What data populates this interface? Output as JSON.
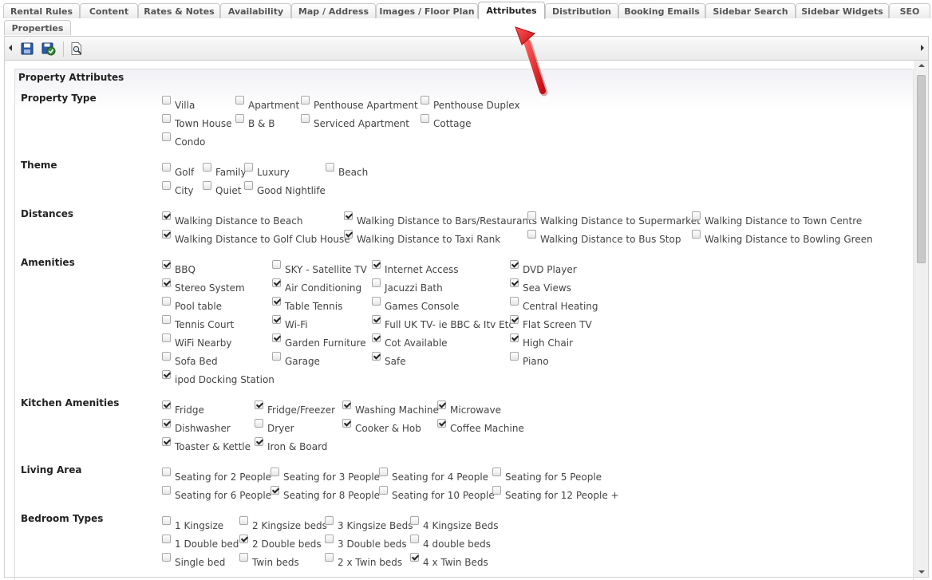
{
  "tabs": [
    {
      "label": "Rental Rules",
      "active": false
    },
    {
      "label": "Content",
      "active": false
    },
    {
      "label": "Rates & Notes",
      "active": false
    },
    {
      "label": "Availability",
      "active": false
    },
    {
      "label": "Map / Address",
      "active": false
    },
    {
      "label": "Images / Floor Plan",
      "active": false
    },
    {
      "label": "Attributes",
      "active": true
    },
    {
      "label": "Distribution",
      "active": false
    },
    {
      "label": "Booking Emails",
      "active": false
    },
    {
      "label": "Sidebar Search",
      "active": false
    },
    {
      "label": "Sidebar Widgets",
      "active": false
    },
    {
      "label": "SEO",
      "active": false
    },
    {
      "label": "Properties",
      "active": false
    }
  ],
  "toolbar": {
    "buttons": [
      {
        "name": "save-icon",
        "color": "#2a5aa8"
      },
      {
        "name": "save-and-close-icon",
        "color": "#3a8a3a"
      },
      {
        "name": "preview-icon",
        "color": "#666666"
      }
    ]
  },
  "panel_title": "Property Attributes",
  "sections": [
    {
      "label": "Property Type",
      "options": [
        {
          "label": "Villa",
          "checked": false
        },
        {
          "label": "Apartment",
          "checked": false
        },
        {
          "label": "Penthouse Apartment",
          "checked": false
        },
        {
          "label": "Penthouse Duplex",
          "checked": false
        },
        {
          "label": "Town House",
          "checked": false
        },
        {
          "label": "B & B",
          "checked": false
        },
        {
          "label": "Serviced Apartment",
          "checked": false
        },
        {
          "label": "Cottage",
          "checked": false
        },
        {
          "label": "Condo",
          "checked": false
        }
      ]
    },
    {
      "label": "Theme",
      "options": [
        {
          "label": "Golf",
          "checked": false
        },
        {
          "label": "Family",
          "checked": false
        },
        {
          "label": "Luxury",
          "checked": false
        },
        {
          "label": "Beach",
          "checked": false
        },
        {
          "label": "City",
          "checked": false
        },
        {
          "label": "Quiet",
          "checked": false
        },
        {
          "label": "Good Nightlife",
          "checked": false
        }
      ]
    },
    {
      "label": "Distances",
      "options": [
        {
          "label": "Walking Distance to Beach",
          "checked": true
        },
        {
          "label": "Walking Distance to Bars/Restaurants",
          "checked": true
        },
        {
          "label": "Walking Distance to Supermarket",
          "checked": false
        },
        {
          "label": "Walking Distance to Town Centre",
          "checked": false
        },
        {
          "label": "Walking Distance to Golf Club House",
          "checked": true
        },
        {
          "label": "Walking Distance to Taxi Rank",
          "checked": true
        },
        {
          "label": "Walking Distance to Bus Stop",
          "checked": false
        },
        {
          "label": "Walking Distance to Bowling Green",
          "checked": false
        }
      ]
    },
    {
      "label": "Amenities",
      "options": [
        {
          "label": "BBQ",
          "checked": true
        },
        {
          "label": "SKY - Satellite TV",
          "checked": false
        },
        {
          "label": "Internet Access",
          "checked": true
        },
        {
          "label": "DVD Player",
          "checked": true
        },
        {
          "label": "Stereo System",
          "checked": true
        },
        {
          "label": "Air Conditioning",
          "checked": true
        },
        {
          "label": "Jacuzzi Bath",
          "checked": false
        },
        {
          "label": "Sea Views",
          "checked": true
        },
        {
          "label": "Pool table",
          "checked": false
        },
        {
          "label": "Table Tennis",
          "checked": true
        },
        {
          "label": "Games Console",
          "checked": false
        },
        {
          "label": "Central Heating",
          "checked": false
        },
        {
          "label": "Tennis Court",
          "checked": false
        },
        {
          "label": "Wi-Fi",
          "checked": true
        },
        {
          "label": "Full UK TV- ie BBC & Itv Etc",
          "checked": true
        },
        {
          "label": "Flat Screen TV",
          "checked": true
        },
        {
          "label": "WiFi Nearby",
          "checked": false
        },
        {
          "label": "Garden Furniture",
          "checked": true
        },
        {
          "label": "Cot Available",
          "checked": true
        },
        {
          "label": "High Chair",
          "checked": true
        },
        {
          "label": "Sofa Bed",
          "checked": false
        },
        {
          "label": "Garage",
          "checked": false
        },
        {
          "label": "Safe",
          "checked": true
        },
        {
          "label": "Piano",
          "checked": false
        },
        {
          "label": "ipod Docking Station",
          "checked": true
        }
      ]
    },
    {
      "label": "Kitchen Amenities",
      "options": [
        {
          "label": "Fridge",
          "checked": true
        },
        {
          "label": "Fridge/Freezer",
          "checked": true
        },
        {
          "label": "Washing Machine",
          "checked": true
        },
        {
          "label": "Microwave",
          "checked": true
        },
        {
          "label": "Dishwasher",
          "checked": true
        },
        {
          "label": "Dryer",
          "checked": false
        },
        {
          "label": "Cooker & Hob",
          "checked": true
        },
        {
          "label": "Coffee Machine",
          "checked": true
        },
        {
          "label": "Toaster & Kettle",
          "checked": true
        },
        {
          "label": "Iron & Board",
          "checked": true
        }
      ]
    },
    {
      "label": "Living Area",
      "options": [
        {
          "label": "Seating for 2 People",
          "checked": false
        },
        {
          "label": "Seating for 3 People",
          "checked": false
        },
        {
          "label": "Seating for 4 People",
          "checked": false
        },
        {
          "label": "Seating for 5 People",
          "checked": false
        },
        {
          "label": "Seating for 6 People",
          "checked": false
        },
        {
          "label": "Seating for 8 People",
          "checked": true
        },
        {
          "label": "Seating for 10 People",
          "checked": false
        },
        {
          "label": "Seating for 12 People +",
          "checked": false
        }
      ]
    },
    {
      "label": "Bedroom Types",
      "options": [
        {
          "label": "1 Kingsize",
          "checked": false
        },
        {
          "label": "2 Kingsize beds",
          "checked": false
        },
        {
          "label": "3 Kingsize Beds",
          "checked": false
        },
        {
          "label": "4 Kingsize Beds",
          "checked": false
        },
        {
          "label": "1 Double bed",
          "checked": false
        },
        {
          "label": "2 Double beds",
          "checked": true
        },
        {
          "label": "3 Double beds",
          "checked": false
        },
        {
          "label": "4 double beds",
          "checked": false
        },
        {
          "label": "Single bed",
          "checked": false
        },
        {
          "label": "Twin beds",
          "checked": false
        },
        {
          "label": "2 x Twin beds",
          "checked": false
        },
        {
          "label": "4 x Twin Beds",
          "checked": true
        }
      ]
    }
  ],
  "accent_color": "#e8151b"
}
